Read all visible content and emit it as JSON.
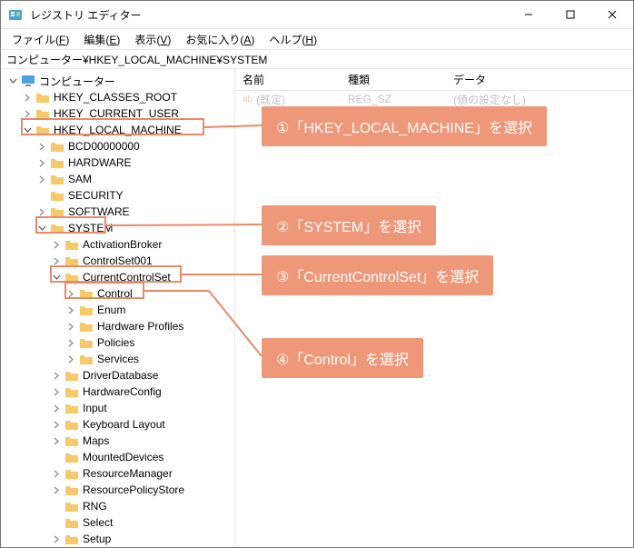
{
  "window": {
    "title": "レジストリ エディター",
    "min": "minimize",
    "max": "maximize",
    "close": "close"
  },
  "menu": {
    "file": "ファイル(F)",
    "edit": "編集(E)",
    "view": "表示(V)",
    "favorites": "お気に入り(A)",
    "help": "ヘルプ(H)"
  },
  "addressbar": "コンピューター¥HKEY_LOCAL_MACHINE¥SYSTEM",
  "tree": {
    "root": "コンピューター",
    "hkcr": "HKEY_CLASSES_ROOT",
    "hkcu": "HKEY_CURRENT_USER",
    "hklm": "HKEY_LOCAL_MACHINE",
    "bcd": "BCD00000000",
    "hardware": "HARDWARE",
    "sam": "SAM",
    "security": "SECURITY",
    "software": "SOFTWARE",
    "system": "SYSTEM",
    "activationbroker": "ActivationBroker",
    "controlset001": "ControlSet001",
    "currentcontrolset": "CurrentControlSet",
    "control": "Control",
    "enum": "Enum",
    "hardwareprofiles": "Hardware Profiles",
    "policies": "Policies",
    "services": "Services",
    "driverdatabase": "DriverDatabase",
    "hardwareconfig": "HardwareConfig",
    "input": "Input",
    "keyboardlayout": "Keyboard Layout",
    "maps": "Maps",
    "mounteddevices": "MountedDevices",
    "resourcemanager": "ResourceManager",
    "resourcepolicystore": "ResourcePolicyStore",
    "rng": "RNG",
    "select": "Select",
    "setup": "Setup"
  },
  "list": {
    "col_name": "名前",
    "col_type": "種類",
    "col_data": "データ",
    "default_name": "(既定)",
    "default_type": "REG_SZ",
    "default_data": "(値の設定なし)"
  },
  "callouts": {
    "c1": "①「HKEY_LOCAL_MACHINE」を選択",
    "c2": "②「SYSTEM」を選択",
    "c3": "③「CurrentControlSet」を選択",
    "c4": "④「Control」を選択"
  }
}
